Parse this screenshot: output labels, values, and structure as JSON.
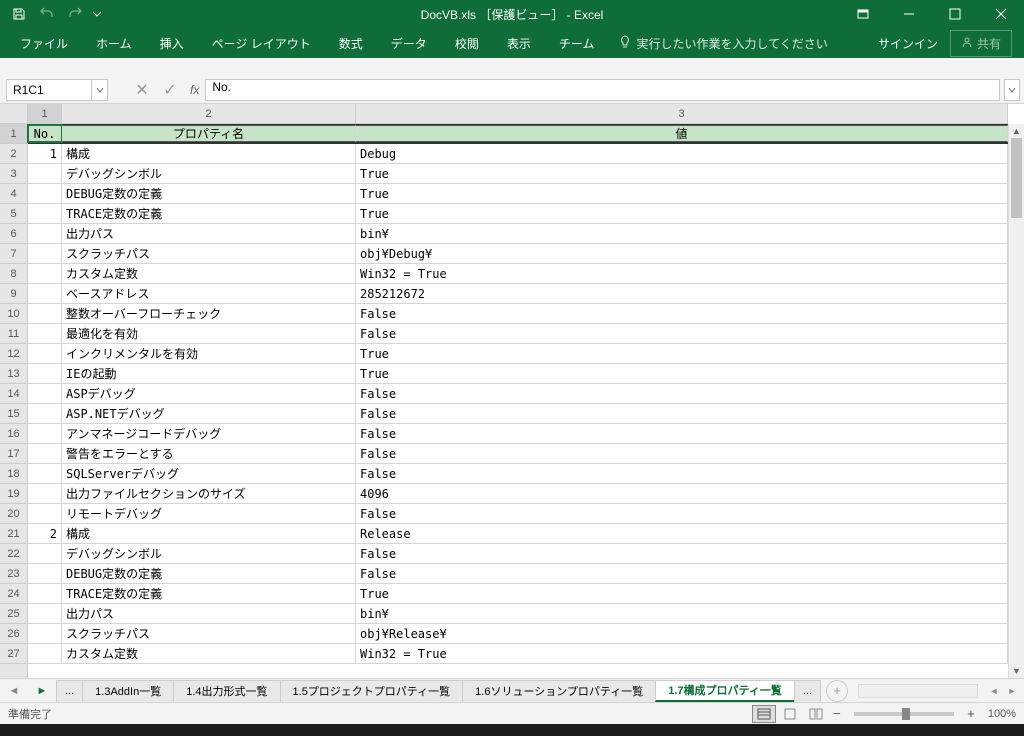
{
  "title": "DocVB.xls ［保護ビュー］ - Excel",
  "qat": {
    "save": "save",
    "undo": "undo",
    "redo": "redo"
  },
  "ribbon_tabs": [
    "ファイル",
    "ホーム",
    "挿入",
    "ページ レイアウト",
    "数式",
    "データ",
    "校閲",
    "表示",
    "チーム"
  ],
  "tell_me": "実行したい作業を入力してください",
  "signin": "サインイン",
  "share": "共有",
  "name_box": "R1C1",
  "formula_value": "No.",
  "col_headers": [
    "1",
    "2",
    "3"
  ],
  "table_headers": {
    "no": "No.",
    "prop": "プロパティ名",
    "val": "値"
  },
  "rows": [
    {
      "no": "1",
      "prop": "構成",
      "val": "Debug"
    },
    {
      "no": "",
      "prop": "デバッグシンボル",
      "val": "True"
    },
    {
      "no": "",
      "prop": "DEBUG定数の定義",
      "val": "True"
    },
    {
      "no": "",
      "prop": "TRACE定数の定義",
      "val": "True"
    },
    {
      "no": "",
      "prop": "出力パス",
      "val": "bin¥"
    },
    {
      "no": "",
      "prop": "スクラッチパス",
      "val": "obj¥Debug¥"
    },
    {
      "no": "",
      "prop": "カスタム定数",
      "val": "Win32 = True"
    },
    {
      "no": "",
      "prop": "ベースアドレス",
      "val": "285212672"
    },
    {
      "no": "",
      "prop": "整数オーバーフローチェック",
      "val": "False"
    },
    {
      "no": "",
      "prop": "最適化を有効",
      "val": "False"
    },
    {
      "no": "",
      "prop": "インクリメンタルを有効",
      "val": "True"
    },
    {
      "no": "",
      "prop": "IEの起動",
      "val": "True"
    },
    {
      "no": "",
      "prop": "ASPデバッグ",
      "val": "False"
    },
    {
      "no": "",
      "prop": "ASP.NETデバッグ",
      "val": "False"
    },
    {
      "no": "",
      "prop": "アンマネージコードデバッグ",
      "val": "False"
    },
    {
      "no": "",
      "prop": "警告をエラーとする",
      "val": "False"
    },
    {
      "no": "",
      "prop": "SQLServerデバッグ",
      "val": "False"
    },
    {
      "no": "",
      "prop": "出力ファイルセクションのサイズ",
      "val": "4096"
    },
    {
      "no": "",
      "prop": "リモートデバッグ",
      "val": "False"
    },
    {
      "no": "2",
      "prop": "構成",
      "val": "Release"
    },
    {
      "no": "",
      "prop": "デバッグシンボル",
      "val": "False"
    },
    {
      "no": "",
      "prop": "DEBUG定数の定義",
      "val": "False"
    },
    {
      "no": "",
      "prop": "TRACE定数の定義",
      "val": "True"
    },
    {
      "no": "",
      "prop": "出力パス",
      "val": "bin¥"
    },
    {
      "no": "",
      "prop": "スクラッチパス",
      "val": "obj¥Release¥"
    },
    {
      "no": "",
      "prop": "カスタム定数",
      "val": "Win32 = True"
    }
  ],
  "sheet_tabs": {
    "more_left": "...",
    "tabs": [
      "1.3AddIn一覧",
      "1.4出力形式一覧",
      "1.5プロジェクトプロパティ一覧",
      "1.6ソリューションプロパティ一覧",
      "1.7構成プロパティ一覧"
    ],
    "active_index": 4,
    "more_right": "..."
  },
  "status": {
    "ready": "準備完了",
    "zoom": "100%"
  }
}
